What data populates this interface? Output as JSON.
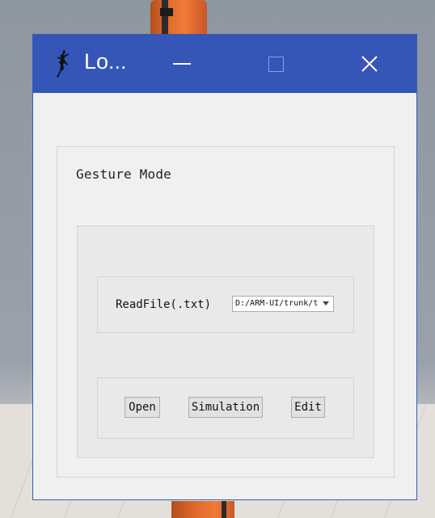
{
  "window": {
    "title": "Lo...",
    "minimize_label": "minimize",
    "maximize_label": "maximize",
    "close_label": "close"
  },
  "gesture": {
    "group_title": "Gesture Mode",
    "read_file_label": "ReadFile(.txt)",
    "file_path": "D:/ARM-UI/trunk/t",
    "buttons": {
      "open": "Open",
      "simulation": "Simulation",
      "edit": "Edit"
    }
  },
  "colors": {
    "titlebar": "#3555b7",
    "window_bg": "#f0f0f0"
  },
  "icons": [
    "app-gecko-icon",
    "minimize-icon",
    "maximize-icon",
    "close-icon",
    "chevron-down-icon"
  ]
}
